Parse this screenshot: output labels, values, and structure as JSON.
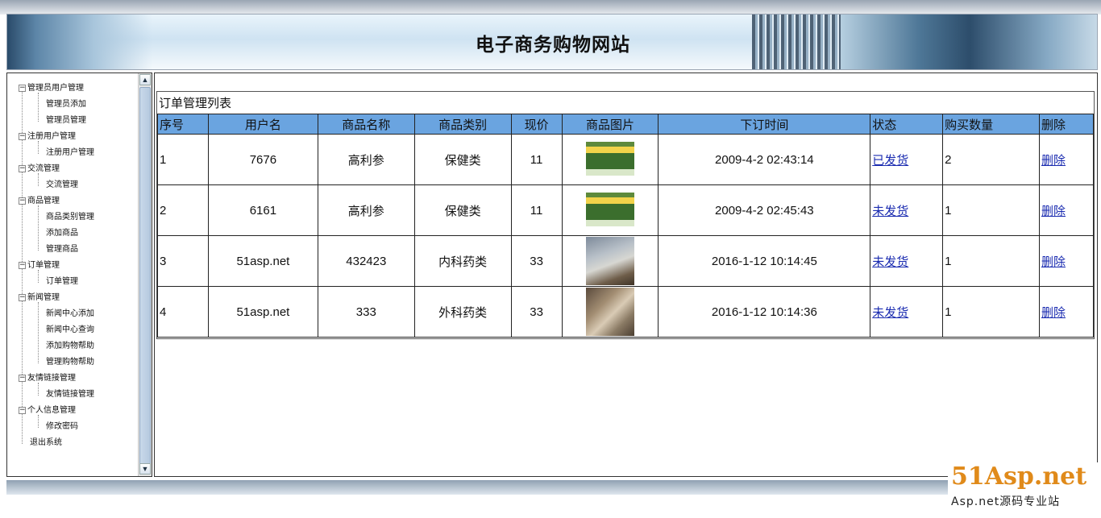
{
  "header": {
    "title": "电子商务购物网站"
  },
  "sidebar": {
    "groups": [
      {
        "label": "管理员用户管理",
        "children": [
          "管理员添加",
          "管理员管理"
        ]
      },
      {
        "label": "注册用户管理",
        "children": [
          "注册用户管理"
        ]
      },
      {
        "label": "交流管理",
        "children": [
          "交流管理"
        ]
      },
      {
        "label": "商品管理",
        "children": [
          "商品类别管理",
          "添加商品",
          "管理商品"
        ]
      },
      {
        "label": "订单管理",
        "children": [
          "订单管理"
        ]
      },
      {
        "label": "新闻管理",
        "children": [
          "新闻中心添加",
          "新闻中心查询",
          "添加购物帮助",
          "管理购物帮助"
        ]
      },
      {
        "label": "友情链接管理",
        "children": [
          "友情链接管理"
        ]
      },
      {
        "label": "个人信息管理",
        "children": [
          "修改密码"
        ]
      }
    ],
    "exit": "退出系统",
    "expander_symbol": "−"
  },
  "main": {
    "list_title": "订单管理列表",
    "columns": [
      "序号",
      "用户名",
      "商品名称",
      "商品类别",
      "现价",
      "商品图片",
      "下订时间",
      "状态",
      "购买数量",
      "删除"
    ],
    "rows": [
      {
        "no": "1",
        "user": "7676",
        "product": "高利参",
        "category": "保健类",
        "price": "11",
        "image": "product-box-icon",
        "time": "2009-4-2 02:43:14",
        "status": "已发货",
        "qty": "2",
        "delete": "删除"
      },
      {
        "no": "2",
        "user": "6161",
        "product": "高利参",
        "category": "保健类",
        "price": "11",
        "image": "product-box-icon",
        "time": "2009-4-2 02:45:43",
        "status": "未发货",
        "qty": "1",
        "delete": "删除"
      },
      {
        "no": "3",
        "user": "51asp.net",
        "product": "432423",
        "category": "内科药类",
        "price": "33",
        "image": "car-photo-icon",
        "time": "2016-1-12 10:14:45",
        "status": "未发货",
        "qty": "1",
        "delete": "删除"
      },
      {
        "no": "4",
        "user": "51asp.net",
        "product": "333",
        "category": "外科药类",
        "price": "33",
        "image": "hand-photo-icon",
        "time": "2016-1-12 10:14:36",
        "status": "未发货",
        "qty": "1",
        "delete": "删除"
      }
    ]
  },
  "watermark": {
    "logo": "51Asp.net",
    "subtitle": "Asp.net源码专业站"
  },
  "colors": {
    "table_header": "#6aa4e0",
    "link": "#1a2bb0",
    "watermark": "#e08a1a"
  }
}
